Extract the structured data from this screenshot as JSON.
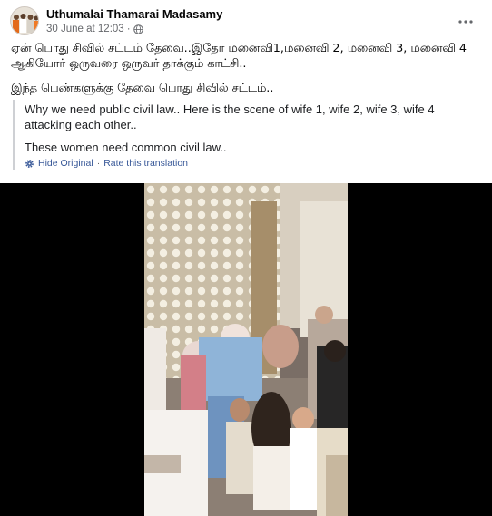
{
  "post": {
    "author": "Uthumalai Thamarai Madasamy",
    "date": "30 June at 12:03",
    "separator": "·",
    "privacy_icon": "globe-icon",
    "more_icon": "more-options-icon"
  },
  "content": {
    "paragraph1": "ஏன் பொது சிவில் சட்டம் தேவை..இதோ மனைவி1,மனைவி 2, மனைவி 3, மனைவி 4 ஆகியோர் ஒருவரை ஒருவர் தாக்கும் காட்சி..",
    "paragraph2": "இந்த பெண்களுக்கு தேவை பொது சிவில் சட்டம்.."
  },
  "translation": {
    "paragraph1": "Why we need public civil law.. Here is the scene of wife 1, wife 2, wife 3, wife 4 attacking each other..",
    "paragraph2": "These women need common civil law..",
    "hide_label": "Hide Original",
    "link_separator": "·",
    "rate_label": "Rate this translation",
    "settings_icon": "gear-icon"
  },
  "colors": {
    "link": "#385898",
    "meta": "#65676b",
    "video_background": "#000000"
  }
}
